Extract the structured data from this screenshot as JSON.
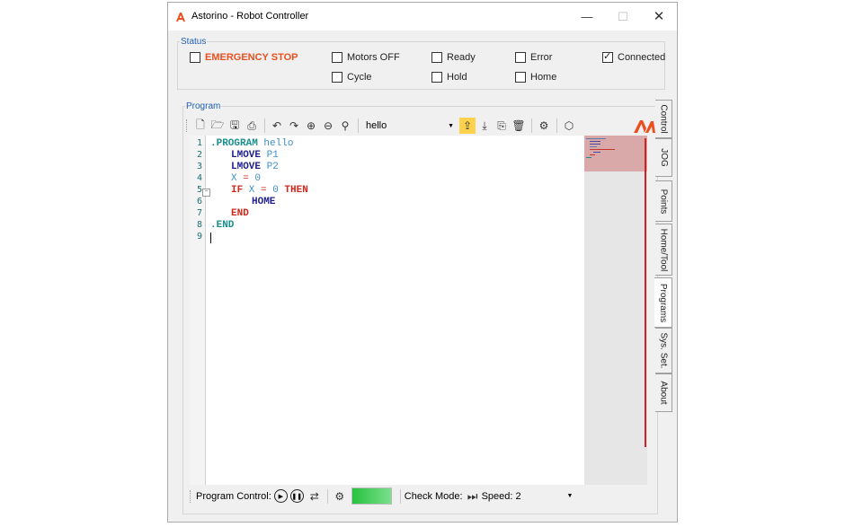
{
  "window": {
    "title": "Astorino - Robot Controller",
    "minimize": "—",
    "maximize": "☐",
    "close": "✕"
  },
  "status": {
    "legend": "Status",
    "items": [
      {
        "label": "EMERGENCY STOP",
        "checked": false
      },
      {
        "label": "Motors OFF",
        "checked": false
      },
      {
        "label": "Ready",
        "checked": false
      },
      {
        "label": "Error",
        "checked": false
      },
      {
        "label": "Connected",
        "checked": true
      },
      {
        "label": "Cycle",
        "checked": false
      },
      {
        "label": "Hold",
        "checked": false
      },
      {
        "label": "Home",
        "checked": false
      }
    ]
  },
  "program": {
    "legend": "Program",
    "program_name": "hello",
    "toolbar_icons": [
      "new-file-icon",
      "open-folder-icon",
      "save-icon",
      "print-icon",
      "undo-icon",
      "redo-icon",
      "zoom-in-icon",
      "zoom-out-icon",
      "search-icon",
      "upload-icon",
      "download-icon",
      "compare-icon",
      "delete-icon",
      "robot-icon",
      "cube-icon"
    ]
  },
  "code": {
    "line_numbers": [
      "1",
      "2",
      "3",
      "4",
      "5",
      "6",
      "7",
      "8",
      "9"
    ],
    "lines": [
      {
        "a": ".PROGRAM",
        "b": " hello"
      },
      {
        "a": "LMOVE",
        "b": " P1"
      },
      {
        "a": "LMOVE",
        "b": " P2"
      },
      {
        "a": "X",
        "b": " = ",
        "c": "0"
      },
      {
        "a": "IF",
        "b": " X",
        "c": " = ",
        "d": "0",
        "e": " THEN"
      },
      {
        "a": "HOME"
      },
      {
        "a": "END"
      },
      {
        "a": ".END"
      }
    ]
  },
  "tabs": [
    "Control",
    "JOG",
    "Points",
    "Home/Tool",
    "Programs",
    "Sys. Set.",
    "About"
  ],
  "active_tab": "Programs",
  "bottom": {
    "program_control_label": "Program Control:",
    "check_mode_label": "Check Mode:",
    "speed_label": "Speed:",
    "speed_value": "2"
  },
  "colors": {
    "brand": "#e8501f",
    "keyword_teal": "#1a8e8e",
    "keyword_navy": "#1e1e8c",
    "keyword_red": "#d0281e",
    "identifier": "#3d8fc9"
  }
}
